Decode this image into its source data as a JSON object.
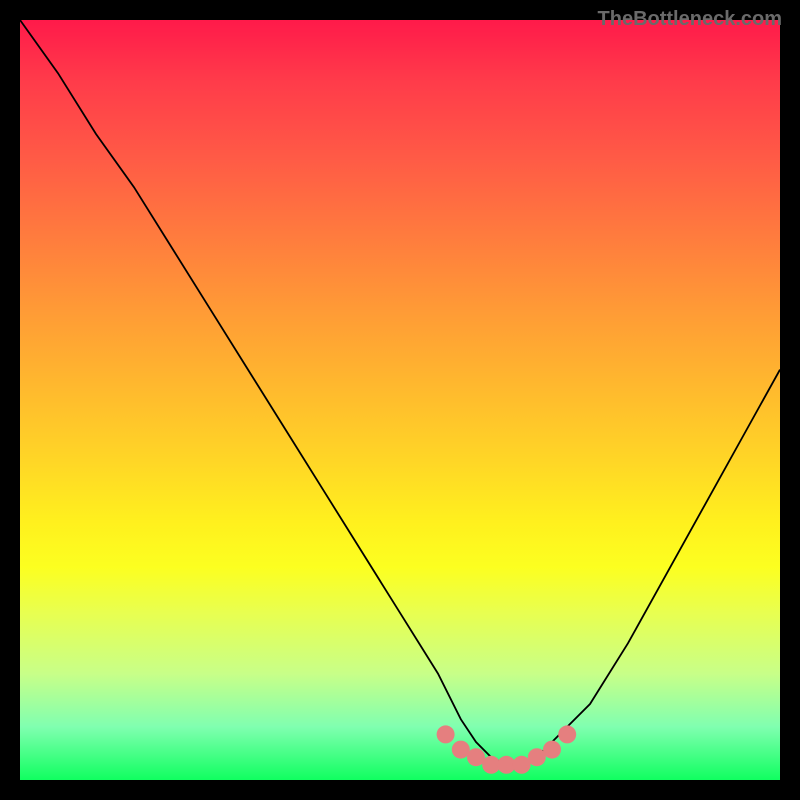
{
  "watermark": "TheBottleneck.com",
  "chart_data": {
    "type": "line",
    "title": "",
    "xlabel": "",
    "ylabel": "",
    "xlim": [
      0,
      100
    ],
    "ylim": [
      0,
      100
    ],
    "grid": false,
    "series": [
      {
        "name": "bottleneck-curve",
        "x": [
          0,
          5,
          10,
          15,
          20,
          25,
          30,
          35,
          40,
          45,
          50,
          55,
          58,
          60,
          62,
          64,
          66,
          68,
          70,
          75,
          80,
          85,
          90,
          95,
          100
        ],
        "values": [
          100,
          93,
          85,
          78,
          70,
          62,
          54,
          46,
          38,
          30,
          22,
          14,
          8,
          5,
          3,
          2,
          2,
          3,
          5,
          10,
          18,
          27,
          36,
          45,
          54
        ]
      }
    ],
    "markers": {
      "name": "bottom-dots",
      "color": "#e57f7f",
      "x": [
        56,
        58,
        60,
        62,
        64,
        66,
        68,
        70,
        72
      ],
      "values": [
        6,
        4,
        3,
        2,
        2,
        2,
        3,
        4,
        6
      ]
    },
    "background_gradient": {
      "stops": [
        {
          "pos": 0.0,
          "color": "#ff1a4a"
        },
        {
          "pos": 0.18,
          "color": "#ff5a46"
        },
        {
          "pos": 0.38,
          "color": "#ff9a36"
        },
        {
          "pos": 0.58,
          "color": "#ffd626"
        },
        {
          "pos": 0.72,
          "color": "#fcff20"
        },
        {
          "pos": 0.86,
          "color": "#c8ff88"
        },
        {
          "pos": 1.0,
          "color": "#10ff60"
        }
      ]
    }
  }
}
